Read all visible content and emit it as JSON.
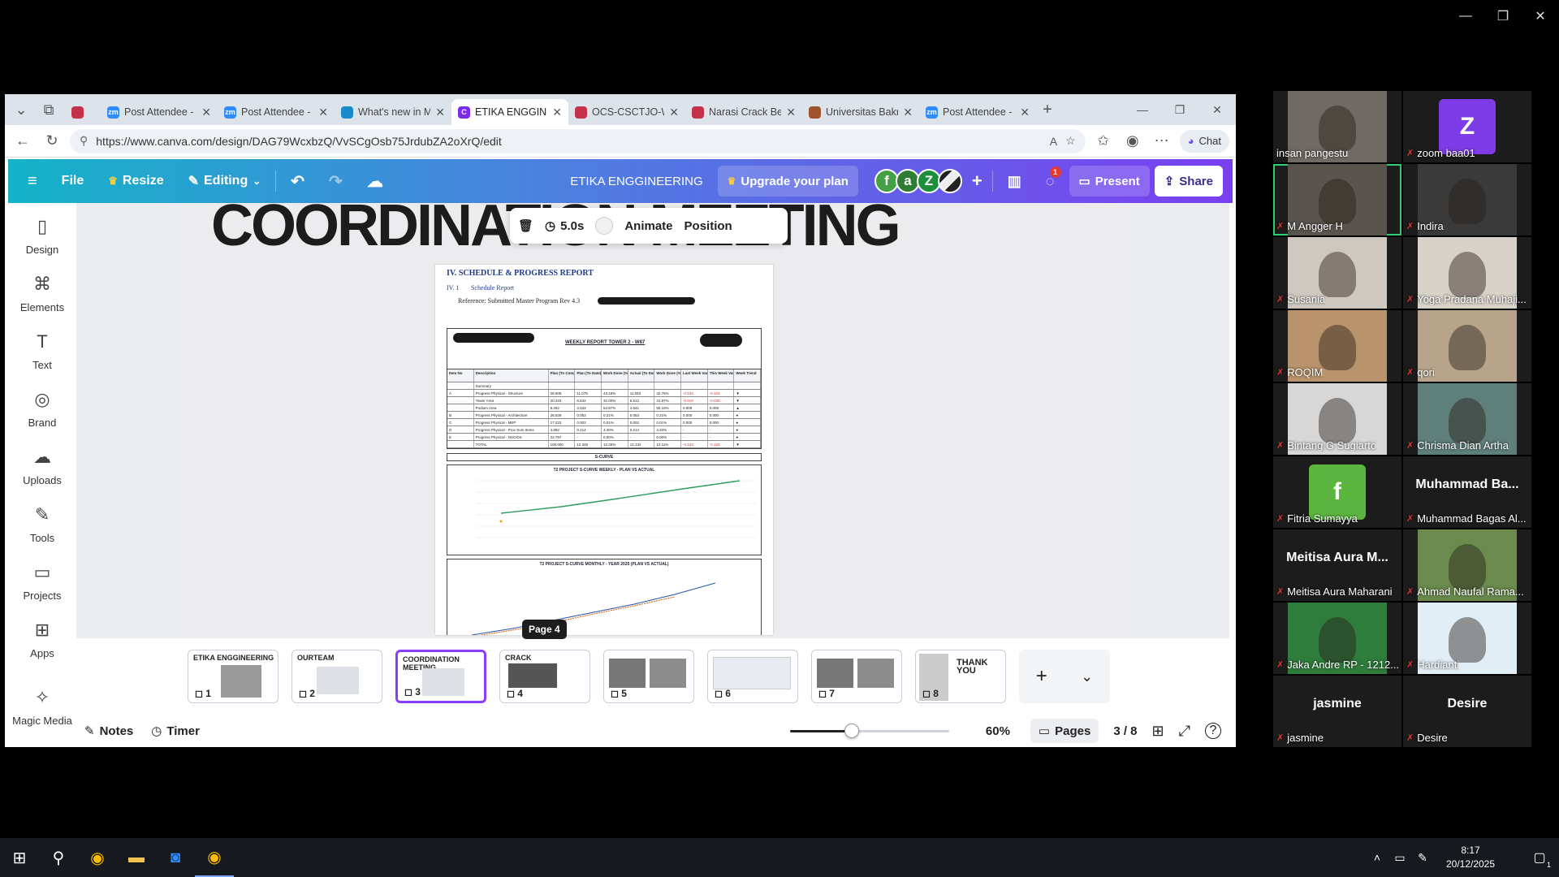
{
  "window_controls": {
    "minimize": "—",
    "maximize": "❐",
    "close": "✕"
  },
  "browser": {
    "tabs": [
      {
        "label": "",
        "icon": "pdf",
        "color": "#c4314b",
        "active": false
      },
      {
        "label": "Post Attendee - Z",
        "icon": "zoom",
        "color": "#2d8cff",
        "active": false
      },
      {
        "label": "Post Attendee - Z",
        "icon": "zoom",
        "color": "#2d8cff",
        "active": false
      },
      {
        "label": "What's new in M",
        "icon": "edge",
        "color": "#1b8aca",
        "active": false
      },
      {
        "label": "ETIKA ENGGINEE",
        "icon": "canva",
        "color": "#7d2ae8",
        "active": true
      },
      {
        "label": "OCS-CSCTJO-W",
        "icon": "pdf",
        "color": "#c4314b",
        "active": false
      },
      {
        "label": "Narasi Crack Bet",
        "icon": "pdf",
        "color": "#c4314b",
        "active": false
      },
      {
        "label": "Universitas Bakri",
        "icon": "univ",
        "color": "#a0522d",
        "active": false
      },
      {
        "label": "Post Attendee - Z",
        "icon": "zoom",
        "color": "#2d8cff",
        "active": false
      }
    ],
    "new_tab": "+",
    "url": "https://www.canva.com/design/DAG79WcxbzQ/VvSCgOsb75JrdubZA2oXrQ/edit",
    "chat_label": "Chat",
    "controls": {
      "minimize": "—",
      "restore": "❐",
      "close": "✕"
    }
  },
  "canva": {
    "toolbar": {
      "file": "File",
      "resize": "Resize",
      "editing": "Editing",
      "doc_title": "ETIKA ENGGINEERING",
      "upgrade": "Upgrade your plan",
      "avatars": [
        {
          "letter": "f",
          "color": "#43a047"
        },
        {
          "letter": "a",
          "color": "#2e7d32"
        },
        {
          "letter": "Z",
          "color": "#1b8f3a"
        },
        {
          "letter": "",
          "color": "#eeeeee"
        }
      ],
      "comment_badge": "1",
      "present": "Present",
      "share": "Share"
    },
    "left_panel": [
      {
        "label": "Design",
        "icon": "design-icon",
        "glyph": "▯"
      },
      {
        "label": "Elements",
        "icon": "elements-icon",
        "glyph": "⌘"
      },
      {
        "label": "Text",
        "icon": "text-icon",
        "glyph": "T"
      },
      {
        "label": "Brand",
        "icon": "brand-icon",
        "glyph": "◎"
      },
      {
        "label": "Uploads",
        "icon": "uploads-icon",
        "glyph": "☁"
      },
      {
        "label": "Tools",
        "icon": "tools-icon",
        "glyph": "✎"
      },
      {
        "label": "Projects",
        "icon": "projects-icon",
        "glyph": "▭"
      },
      {
        "label": "Apps",
        "icon": "apps-icon",
        "glyph": "⊞"
      },
      {
        "label": "Magic Media",
        "icon": "magic-media-icon",
        "glyph": "✧"
      }
    ],
    "slide_title": "COORDINATION MEETING",
    "float_toolbar": {
      "duration": "5.0s",
      "animate": "Animate",
      "position": "Position"
    },
    "document": {
      "heading": "IV. SCHEDULE & PROGRESS REPORT",
      "subheading_num": "IV. 1",
      "subheading": "Schedule Report",
      "reference": "Reference: Submitted Master Program Rev 4.3",
      "report_title": "WEEKLY REPORT TOWER 2 - W87",
      "table_header": [
        "Item No",
        "Description",
        "Plan (To Complete)",
        "Plan (To Date) Deviation",
        "Work Done (%)",
        "Actual (To Date)",
        "Work Done (%)",
        "Last Week Var.",
        "This Week Var.",
        "Week Trend"
      ],
      "table_rows": [
        [
          "",
          "Summary",
          "",
          "",
          "",
          "",
          "",
          "",
          "",
          ""
        ],
        [
          "A",
          "Progress Physical - Structure",
          "28.605",
          "11.075",
          "43.15%",
          "11.053",
          "42.75%",
          "-0.133",
          "-0.133",
          "▼"
        ],
        [
          "",
          "Tower Area",
          "20.433",
          "6.542",
          "32.00%",
          "6.512",
          "31.87%",
          "-0.019",
          "-0.030",
          "▼"
        ],
        [
          "",
          "Podium Area",
          "8.262",
          "4.533",
          "54.87%",
          "4.541",
          "55.15%",
          "0.009",
          "0.008",
          "▲"
        ],
        [
          "B",
          "Progress Physical - Architecture",
          "26.539",
          "0.053",
          "0.21%",
          "0.053",
          "0.21%",
          "0.000",
          "0.000",
          "●"
        ],
        [
          "C",
          "Progress Physical - MEP",
          "17.223",
          "0.002",
          "0.01%",
          "0.002",
          "0.01%",
          "0.000",
          "0.000",
          "●"
        ],
        [
          "D",
          "Progress Physical - Prov Sum Items",
          "4.892",
          "0.214",
          "4.40%",
          "0.214",
          "4.40%",
          "-",
          "-",
          "●"
        ],
        [
          "E",
          "Progress Physical - NSC/DS",
          "22.797",
          "-",
          "0.00%",
          "-",
          "0.00%",
          "-",
          "-",
          "●"
        ],
        [
          "",
          "TOTAL",
          "100.000",
          "12.346",
          "12.35%",
          "12.132",
          "12.11%",
          "-0.133",
          "-0.133",
          "▼"
        ]
      ],
      "scurve_label": "S-CURVE",
      "chart1_title": "T2 PROJECT S-CURVE WEEKLY - PLAN VS ACTUAL",
      "chart2_title": "T2 PROJECT S-CURVE MONTHLY - YEAR 2025 (PLAN VS ACTUAL)"
    },
    "page_tooltip": "Page 4",
    "pages": [
      {
        "num": "1",
        "title": "ETIKA ENGGINEERING",
        "selected": false
      },
      {
        "num": "2",
        "title": "OURTEAM",
        "selected": false
      },
      {
        "num": "3",
        "title": "COORDINATION MEETING",
        "selected": true
      },
      {
        "num": "4",
        "title": "CRACK",
        "selected": false
      },
      {
        "num": "5",
        "title": "",
        "selected": false
      },
      {
        "num": "6",
        "title": "",
        "selected": false
      },
      {
        "num": "7",
        "title": "",
        "selected": false
      },
      {
        "num": "8",
        "title": "THANK YOU",
        "selected": false
      }
    ],
    "bottom": {
      "notes": "Notes",
      "timer": "Timer",
      "zoom": "60%",
      "zoom_fraction": 0.39,
      "pages_label": "Pages",
      "page_count": "3 / 8"
    }
  },
  "zoom_meeting": {
    "participants": [
      {
        "name": "insan pangestu",
        "type": "video",
        "bg": "#6f6a63",
        "muted": false
      },
      {
        "name": "zoom baa01",
        "type": "letter",
        "letter": "Z",
        "bg": "#7d3ce8",
        "muted": true
      },
      {
        "name": "M Angger H",
        "type": "video",
        "bg": "#5a544e",
        "muted": true,
        "active": true
      },
      {
        "name": "Indira",
        "type": "video",
        "bg": "#3a3a3a",
        "muted": true
      },
      {
        "name": "Susania",
        "type": "video",
        "bg": "#cfc8c0",
        "muted": true
      },
      {
        "name": "Yoga Pradana Muhaji...",
        "type": "video",
        "bg": "#d9d2c8",
        "muted": true
      },
      {
        "name": "ROQIM",
        "type": "video",
        "bg": "#b9936b",
        "muted": true
      },
      {
        "name": "qori",
        "type": "video",
        "bg": "#b7a48a",
        "muted": true
      },
      {
        "name": "Bintang G Sugiarto",
        "type": "video",
        "bg": "#d7d7d7",
        "muted": true
      },
      {
        "name": "Chrisma Dian Artha",
        "type": "video",
        "bg": "#5f7f7a",
        "muted": true
      },
      {
        "name": "Fitria Sumayya",
        "type": "letter",
        "letter": "f",
        "bg": "#5bb53e",
        "muted": true
      },
      {
        "name": "Muhammad Bagas Al...",
        "type": "text",
        "big": "Muhammad Ba...",
        "muted": true
      },
      {
        "name": "Meitisa Aura Maharani",
        "type": "text",
        "big": "Meitisa Aura M...",
        "muted": true
      },
      {
        "name": "Ahmad Naufal Rama...",
        "type": "video",
        "bg": "#6b8a4e",
        "muted": true
      },
      {
        "name": "Jaka Andre RP - 1212...",
        "type": "video",
        "bg": "#2f7d3c",
        "muted": true
      },
      {
        "name": "Hardianti",
        "type": "video",
        "bg": "#e2eef6",
        "muted": true
      },
      {
        "name": "jasmine",
        "type": "text",
        "big": "jasmine",
        "muted": true
      },
      {
        "name": "Desire",
        "type": "text",
        "big": "Desire",
        "muted": true
      }
    ]
  },
  "taskbar": {
    "time": "8:17",
    "date": "20/12/2025",
    "notifications": "1"
  }
}
